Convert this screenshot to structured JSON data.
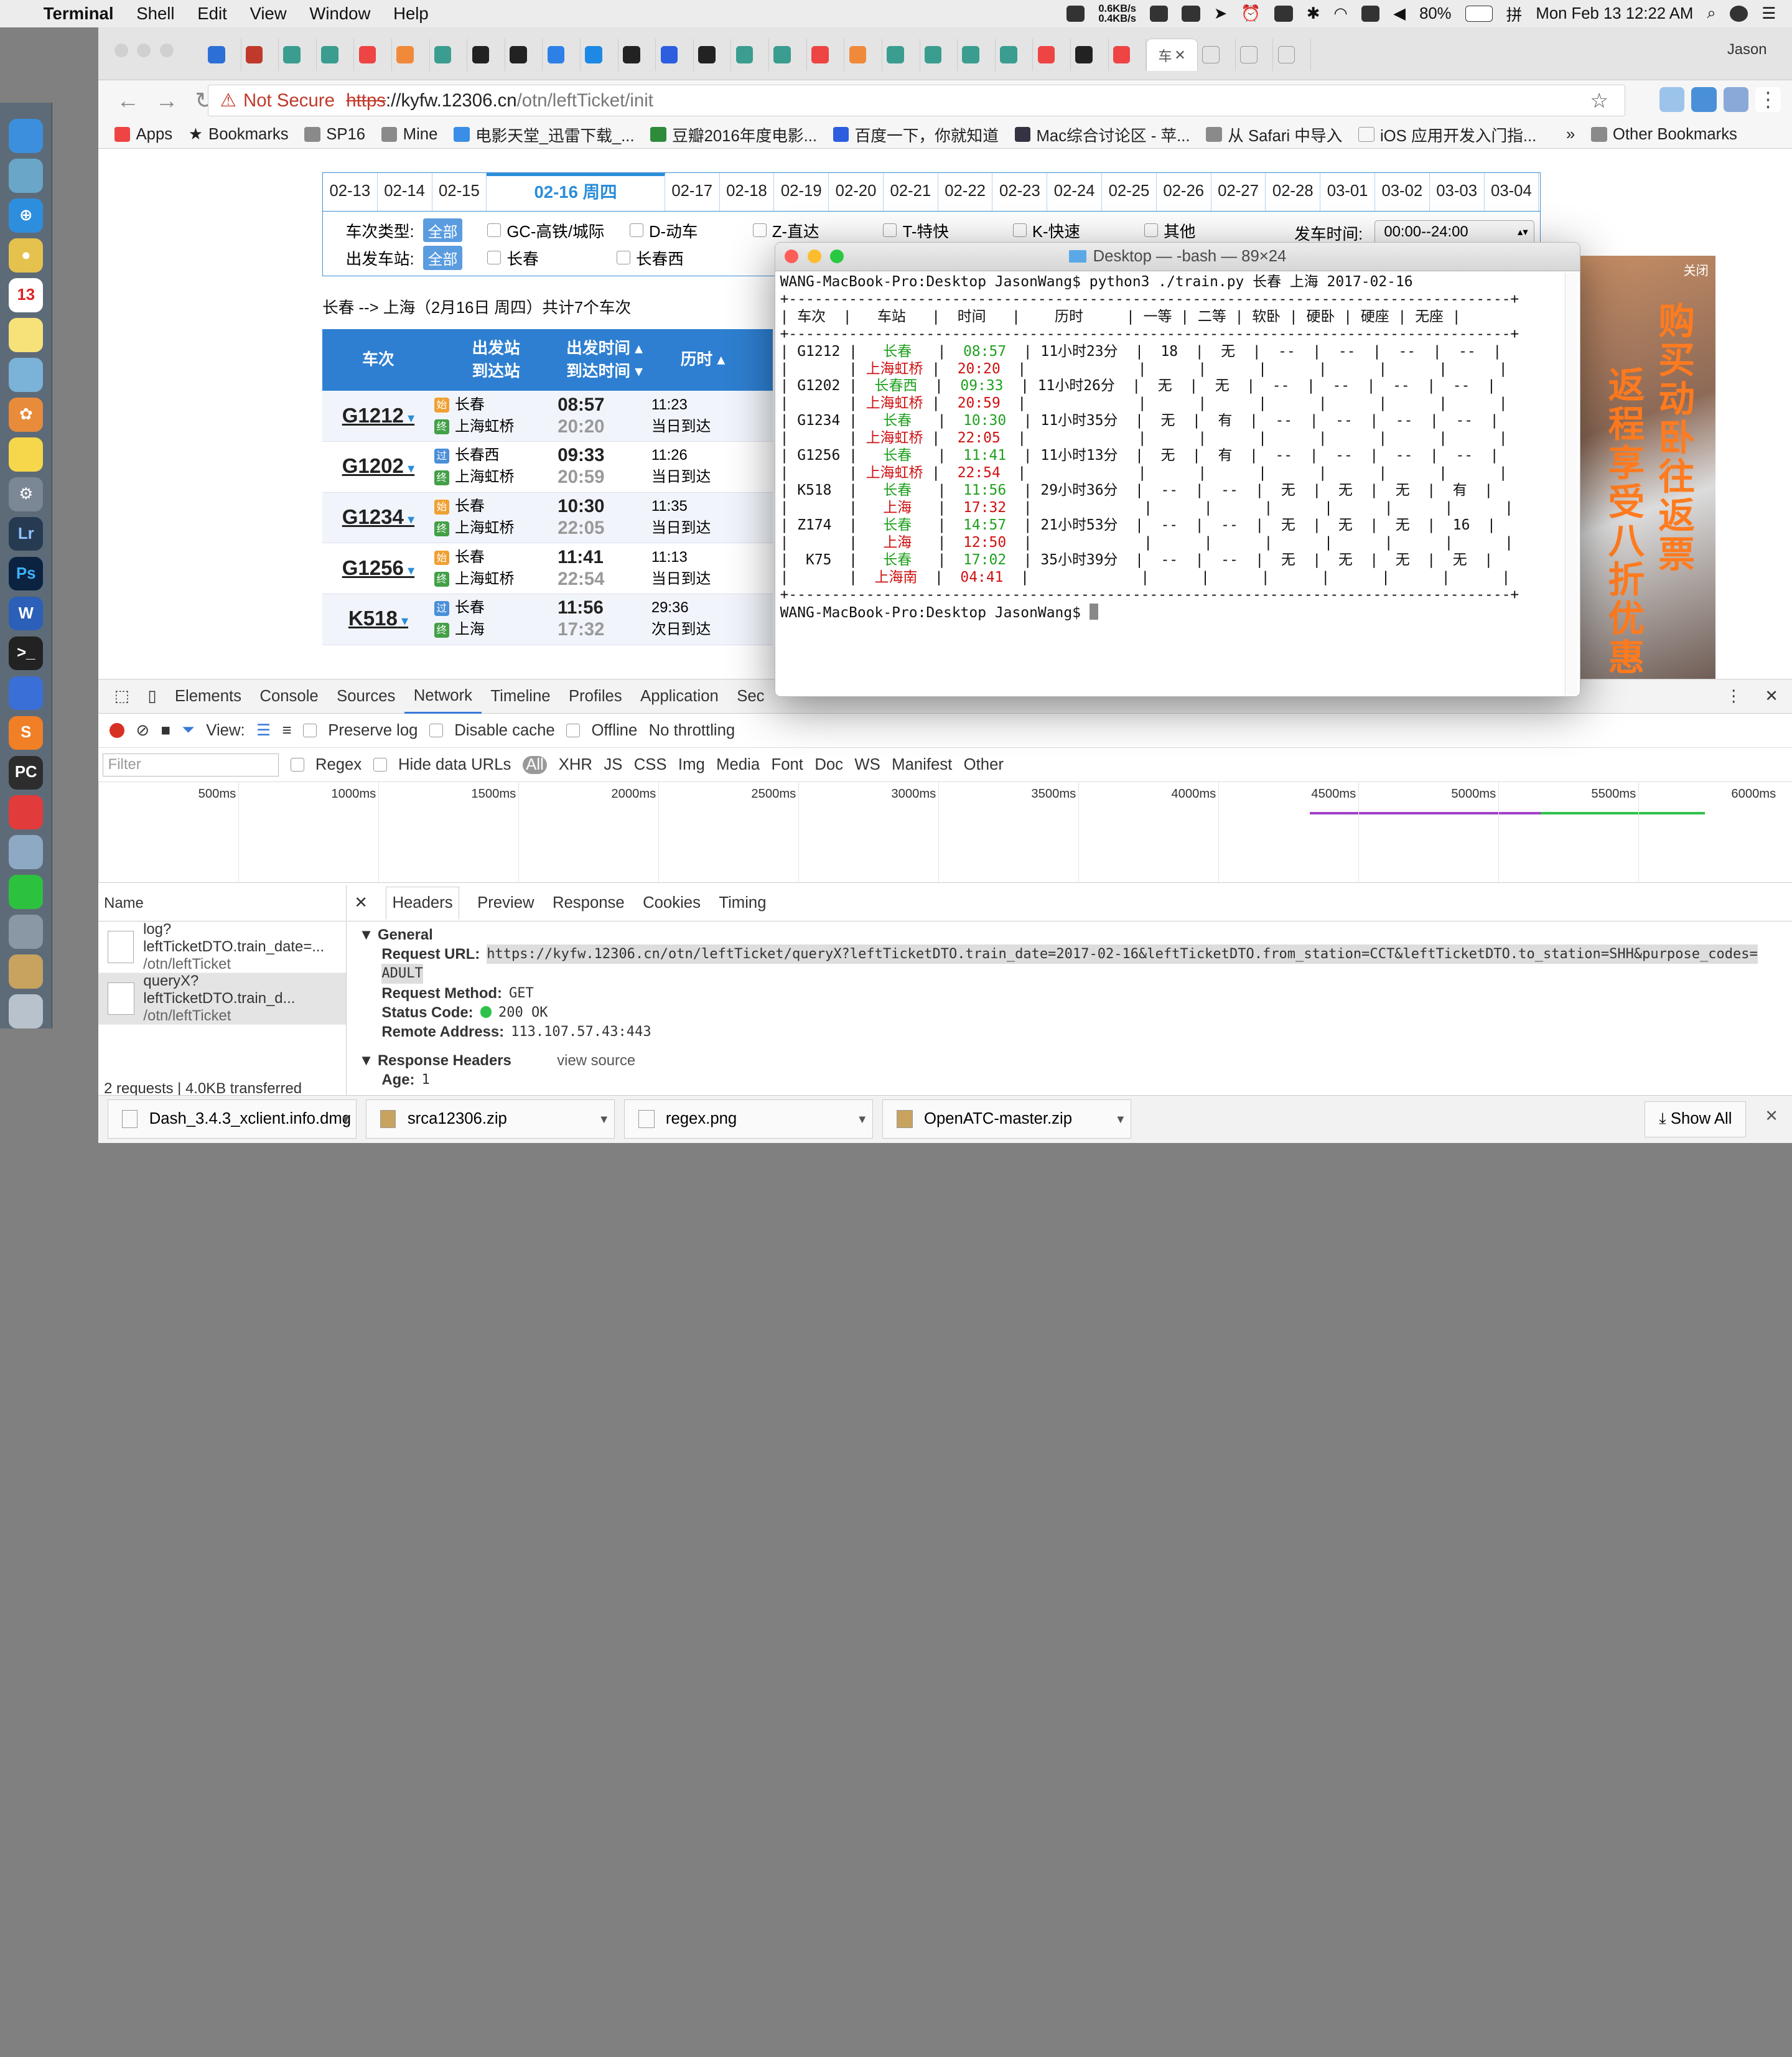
{
  "menubar": {
    "app": "Terminal",
    "items": [
      "Shell",
      "Edit",
      "View",
      "Window",
      "Help"
    ],
    "net_up": "0.6KB/s",
    "net_down": "0.4KB/s",
    "battery": "80%",
    "input": "拼",
    "clock": "Mon Feb 13  12:22 AM"
  },
  "browser": {
    "profile": "Jason",
    "active_tab": "车",
    "omnibox": {
      "warn_icon": "⚠",
      "not_secure": "Not Secure",
      "scheme": "https",
      "host": "://kyfw.12306.cn",
      "path": "/otn/leftTicket/init"
    },
    "bookmarks": [
      "Apps",
      "Bookmarks",
      "SP16",
      "Mine",
      "电影天堂_迅雷下载_...",
      "豆瓣2016年度电影...",
      "百度一下，你就知道",
      "Mac综合讨论区 - 苹...",
      "从 Safari 中导入",
      "iOS 应用开发入门指...",
      "Other Bookmarks"
    ]
  },
  "page": {
    "dates": [
      "02-13",
      "02-14",
      "02-15",
      "02-16 周四",
      "02-17",
      "02-18",
      "02-19",
      "02-20",
      "02-21",
      "02-22",
      "02-23",
      "02-24",
      "02-25",
      "02-26",
      "02-27",
      "02-28",
      "03-01",
      "03-02",
      "03-03",
      "03-04"
    ],
    "selected_date": "02-16 周四",
    "filters": {
      "type_label": "车次类型:",
      "all": "全部",
      "types": [
        "GC-高铁/城际",
        "D-动车",
        "Z-直达",
        "T-特快",
        "K-快速",
        "其他"
      ],
      "station_label": "出发车站:",
      "stations": [
        "长春",
        "长春西"
      ],
      "time_label": "发车时间:",
      "time_value": "00:00--24:00"
    },
    "route_summary": "长春 --> 上海（2月16日  周四）共计7个车次",
    "headers": {
      "train": "车次",
      "stations_a": "出发站",
      "stations_b": "到达站",
      "times_a": "出发时间 ▴",
      "times_b": "到达时间 ▾",
      "duration": "历时 ▴"
    },
    "trains": [
      {
        "no": "G1212",
        "from_tag": "始",
        "from": "长春",
        "to_tag": "终",
        "to": "上海虹桥",
        "dep": "08:57",
        "arr": "20:20",
        "dur": "11:23",
        "day": "当日到达"
      },
      {
        "no": "G1202",
        "from_tag": "过",
        "from": "长春西",
        "to_tag": "终",
        "to": "上海虹桥",
        "dep": "09:33",
        "arr": "20:59",
        "dur": "11:26",
        "day": "当日到达"
      },
      {
        "no": "G1234",
        "from_tag": "始",
        "from": "长春",
        "to_tag": "终",
        "to": "上海虹桥",
        "dep": "10:30",
        "arr": "22:05",
        "dur": "11:35",
        "day": "当日到达"
      },
      {
        "no": "G1256",
        "from_tag": "始",
        "from": "长春",
        "to_tag": "终",
        "to": "上海虹桥",
        "dep": "11:41",
        "arr": "22:54",
        "dur": "11:13",
        "day": "当日到达"
      },
      {
        "no": "K518",
        "from_tag": "过",
        "from": "长春",
        "to_tag": "终",
        "to": "上海",
        "dep": "11:56",
        "arr": "17:32",
        "dur": "29:36",
        "day": "次日到达"
      }
    ],
    "ad": {
      "close": "关闭",
      "line1": "购买动卧往返票",
      "line2": "返程享受八折优惠"
    }
  },
  "devtools": {
    "tabs": [
      "Elements",
      "Console",
      "Sources",
      "Network",
      "Timeline",
      "Profiles",
      "Application",
      "Sec"
    ],
    "active_tab": "Network",
    "controls": {
      "view": "View:",
      "preserve": "Preserve log",
      "disable_cache": "Disable cache",
      "offline": "Offline",
      "throttle": "No throttling"
    },
    "filter_placeholder": "Filter",
    "regex": "Regex",
    "hide_urls": "Hide data URLs",
    "types": [
      "All",
      "XHR",
      "JS",
      "CSS",
      "Img",
      "Media",
      "Font",
      "Doc",
      "WS",
      "Manifest",
      "Other"
    ],
    "ticks": [
      "500ms",
      "1000ms",
      "1500ms",
      "2000ms",
      "2500ms",
      "3000ms",
      "3500ms",
      "4000ms",
      "4500ms",
      "5000ms",
      "5500ms",
      "6000ms"
    ],
    "name_header": "Name",
    "requests": [
      {
        "name": "log?leftTicketDTO.train_date=...",
        "path": "/otn/leftTicket"
      },
      {
        "name": "queryX?leftTicketDTO.train_d...",
        "path": "/otn/leftTicket"
      }
    ],
    "summary": "2 requests | 4.0KB transferred",
    "detail_tabs": [
      "Headers",
      "Preview",
      "Response",
      "Cookies",
      "Timing"
    ],
    "general": "▼ General",
    "request_url_label": "Request URL:",
    "request_url": "https://kyfw.12306.cn/otn/leftTicket/queryX?leftTicketDTO.train_date=2017-02-16&leftTicketDTO.from_station=CCT&leftTicketDTO.to_station=SHH&purpose_codes=",
    "request_url_cont": "ADULT",
    "method_label": "Request Method:",
    "method": "GET",
    "status_label": "Status Code:",
    "status": "200 OK",
    "remote_label": "Remote Address:",
    "remote": "113.107.57.43:443",
    "resp_headers": "▼ Response Headers",
    "view_source": "view source",
    "age_label": "Age:",
    "age": "1"
  },
  "downloads": {
    "items": [
      "Dash_3.4.3_xclient.info.dmg",
      "srca12306.zip",
      "regex.png",
      "OpenATC-master.zip"
    ],
    "show_all": "Show All"
  },
  "terminal": {
    "title": "Desktop — -bash — 89×24",
    "cmd": "WANG-MacBook-Pro:Desktop JasonWang$ python3 ./train.py 长春 上海 2017-02-16",
    "prompt": "WANG-MacBook-Pro:Desktop JasonWang$ ",
    "columns": [
      "车次",
      "车站",
      "时间",
      "历时",
      "一等",
      "二等",
      "软卧",
      "硬卧",
      "硬座",
      "无座"
    ],
    "rows": [
      {
        "no": "G1212",
        "from": "长春",
        "to": "上海虹桥",
        "dep": "08:57",
        "arr": "20:20",
        "dur": "11小时23分",
        "c1": "18",
        "c2": "无",
        "c3": "--",
        "c4": "--",
        "c5": "--",
        "c6": "--"
      },
      {
        "no": "G1202",
        "from": "长春西",
        "to": "上海虹桥",
        "dep": "09:33",
        "arr": "20:59",
        "dur": "11小时26分",
        "c1": "无",
        "c2": "无",
        "c3": "--",
        "c4": "--",
        "c5": "--",
        "c6": "--"
      },
      {
        "no": "G1234",
        "from": "长春",
        "to": "上海虹桥",
        "dep": "10:30",
        "arr": "22:05",
        "dur": "11小时35分",
        "c1": "无",
        "c2": "有",
        "c3": "--",
        "c4": "--",
        "c5": "--",
        "c6": "--"
      },
      {
        "no": "G1256",
        "from": "长春",
        "to": "上海虹桥",
        "dep": "11:41",
        "arr": "22:54",
        "dur": "11小时13分",
        "c1": "无",
        "c2": "有",
        "c3": "--",
        "c4": "--",
        "c5": "--",
        "c6": "--"
      },
      {
        "no": "K518",
        "from": "长春",
        "to": "上海",
        "dep": "11:56",
        "arr": "17:32",
        "dur": "29小时36分",
        "c1": "--",
        "c2": "--",
        "c3": "无",
        "c4": "无",
        "c5": "无",
        "c6": "有"
      },
      {
        "no": "Z174",
        "from": "长春",
        "to": "上海",
        "dep": "14:57",
        "arr": "12:50",
        "dur": "21小时53分",
        "c1": "--",
        "c2": "--",
        "c3": "无",
        "c4": "无",
        "c5": "无",
        "c6": "16"
      },
      {
        "no": "K75",
        "from": "长春",
        "to": "上海南",
        "dep": "17:02",
        "arr": "04:41",
        "dur": "35小时39分",
        "c1": "--",
        "c2": "--",
        "c3": "无",
        "c4": "无",
        "c5": "无",
        "c6": "无"
      }
    ]
  }
}
